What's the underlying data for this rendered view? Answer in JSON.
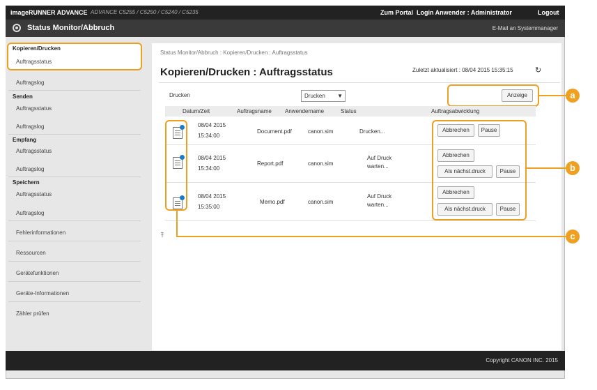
{
  "topbar": {
    "brand": "imageRUNNER ADVANCE",
    "model": "ADVANCE C5255 / C5250 / C5240 / C5235",
    "portal": "Zum Portal",
    "login": "Login Anwender :  Administrator",
    "logout": "Logout"
  },
  "titlebar": {
    "title": "Status Monitor/Abbruch",
    "email": "E-Mail an Systemmanager"
  },
  "sidebar": {
    "kopieren_head": "Kopieren/Drucken",
    "kopieren_status": "Auftragsstatus",
    "kopieren_log": "Auftragslog",
    "senden_head": "Senden",
    "senden_status": "Auftragsstatus",
    "senden_log": "Auftragslog",
    "empfang_head": "Empfang",
    "empfang_status": "Auftragsstatus",
    "empfang_log": "Auftragslog",
    "speichern_head": "Speichern",
    "speichern_status": "Auftragsstatus",
    "speichern_log": "Auftragslog",
    "fehler": "Fehlerinformationen",
    "ressourcen": "Ressourcen",
    "geraetefunktionen": "Gerätefunktionen",
    "geraeteinfo": "Geräte-Informationen",
    "zaehler": "Zähler prüfen"
  },
  "content": {
    "breadcrumb": "Status Monitor/Abbruch : Kopieren/Drucken : Auftragsstatus",
    "title": "Kopieren/Drucken : Auftragsstatus",
    "updated": "Zuletzt aktualisiert : 08/04 2015 15:35:15",
    "refresh_icon": "refresh-icon",
    "section_label": "Drucken",
    "filter_value": "Drucken",
    "display_button": "Anzeige"
  },
  "table": {
    "headers": {
      "datum": "Datum/Zeit",
      "auftragsname": "Auftragsname",
      "anwender": "Anwendername",
      "status": "Status",
      "abwicklung": "Auftragsabwicklung"
    },
    "rows": [
      {
        "date": "08/04 2015",
        "time": "15:34:00",
        "name": "Document.pdf",
        "user": "canon.sim",
        "status1": "Drucken...",
        "status2": "",
        "cancel": "Abbrechen",
        "priority": "",
        "pause": "Pause"
      },
      {
        "date": "08/04 2015",
        "time": "15:34:00",
        "name": "Report.pdf",
        "user": "canon.sim",
        "status1": "Auf Druck",
        "status2": "warten...",
        "cancel": "Abbrechen",
        "priority": "Als nächst.druck",
        "pause": "Pause"
      },
      {
        "date": "08/04 2015",
        "time": "15:35:00",
        "name": "Memo.pdf",
        "user": "canon.sim",
        "status1": "Auf Druck",
        "status2": "warten...",
        "cancel": "Abbrechen",
        "priority": "Als nächst.druck",
        "pause": "Pause"
      }
    ]
  },
  "callouts": {
    "a": "a",
    "b": "b",
    "c": "c"
  },
  "scroll_top": "⤒",
  "footer": {
    "copyright": "Copyright CANON INC. 2015"
  },
  "colors": {
    "highlight": "#f0a020",
    "topbar": "#222222",
    "titlebar": "#3a3a3a"
  }
}
